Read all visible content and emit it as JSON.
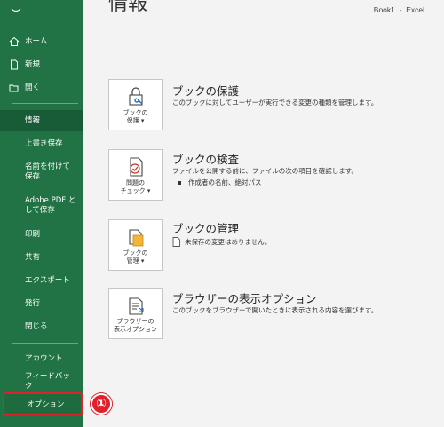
{
  "window": {
    "book": "Book1",
    "separator": "-",
    "app": "Excel"
  },
  "page_title": "情報",
  "sidebar": {
    "top_items": [
      {
        "label": "ホーム",
        "icon": "home-icon"
      },
      {
        "label": "新規",
        "icon": "new-document-icon"
      },
      {
        "label": "開く",
        "icon": "folder-open-icon"
      }
    ],
    "items": [
      {
        "label": "情報"
      },
      {
        "label": "上書き保存"
      },
      {
        "label": "名前を付けて保存"
      },
      {
        "label": "Adobe PDF として保存"
      },
      {
        "label": "印刷"
      },
      {
        "label": "共有"
      },
      {
        "label": "エクスポート"
      },
      {
        "label": "発行"
      },
      {
        "label": "閉じる"
      }
    ],
    "bottom_items": [
      {
        "label": "アカウント"
      },
      {
        "label": "フィードバック"
      },
      {
        "label": "オプション"
      }
    ]
  },
  "marker": "①",
  "sections": [
    {
      "button_line1": "ブックの",
      "button_line2": "保護",
      "title": "ブックの保護",
      "desc": "このブックに対してユーザーが実行できる変更の種類を管理します。",
      "icon": "lock-icon"
    },
    {
      "button_line1": "問題の",
      "button_line2": "チェック",
      "title": "ブックの検査",
      "desc": "ファイルを公開する前に、ファイルの次の項目を確認します。",
      "bullet": "作成者の名前、絶対パス",
      "icon": "inspect-icon"
    },
    {
      "button_line1": "ブックの",
      "button_line2": "管理",
      "title": "ブックの管理",
      "desc": "未保存の変更はありません。",
      "icon": "manage-workbook-icon"
    },
    {
      "button_line1": "ブラウザーの",
      "button_line2": "表示オプション",
      "title": "ブラウザーの表示オプション",
      "desc": "このブックをブラウザーで開いたときに表示される内容を選びます。",
      "icon": "browser-view-icon"
    }
  ]
}
